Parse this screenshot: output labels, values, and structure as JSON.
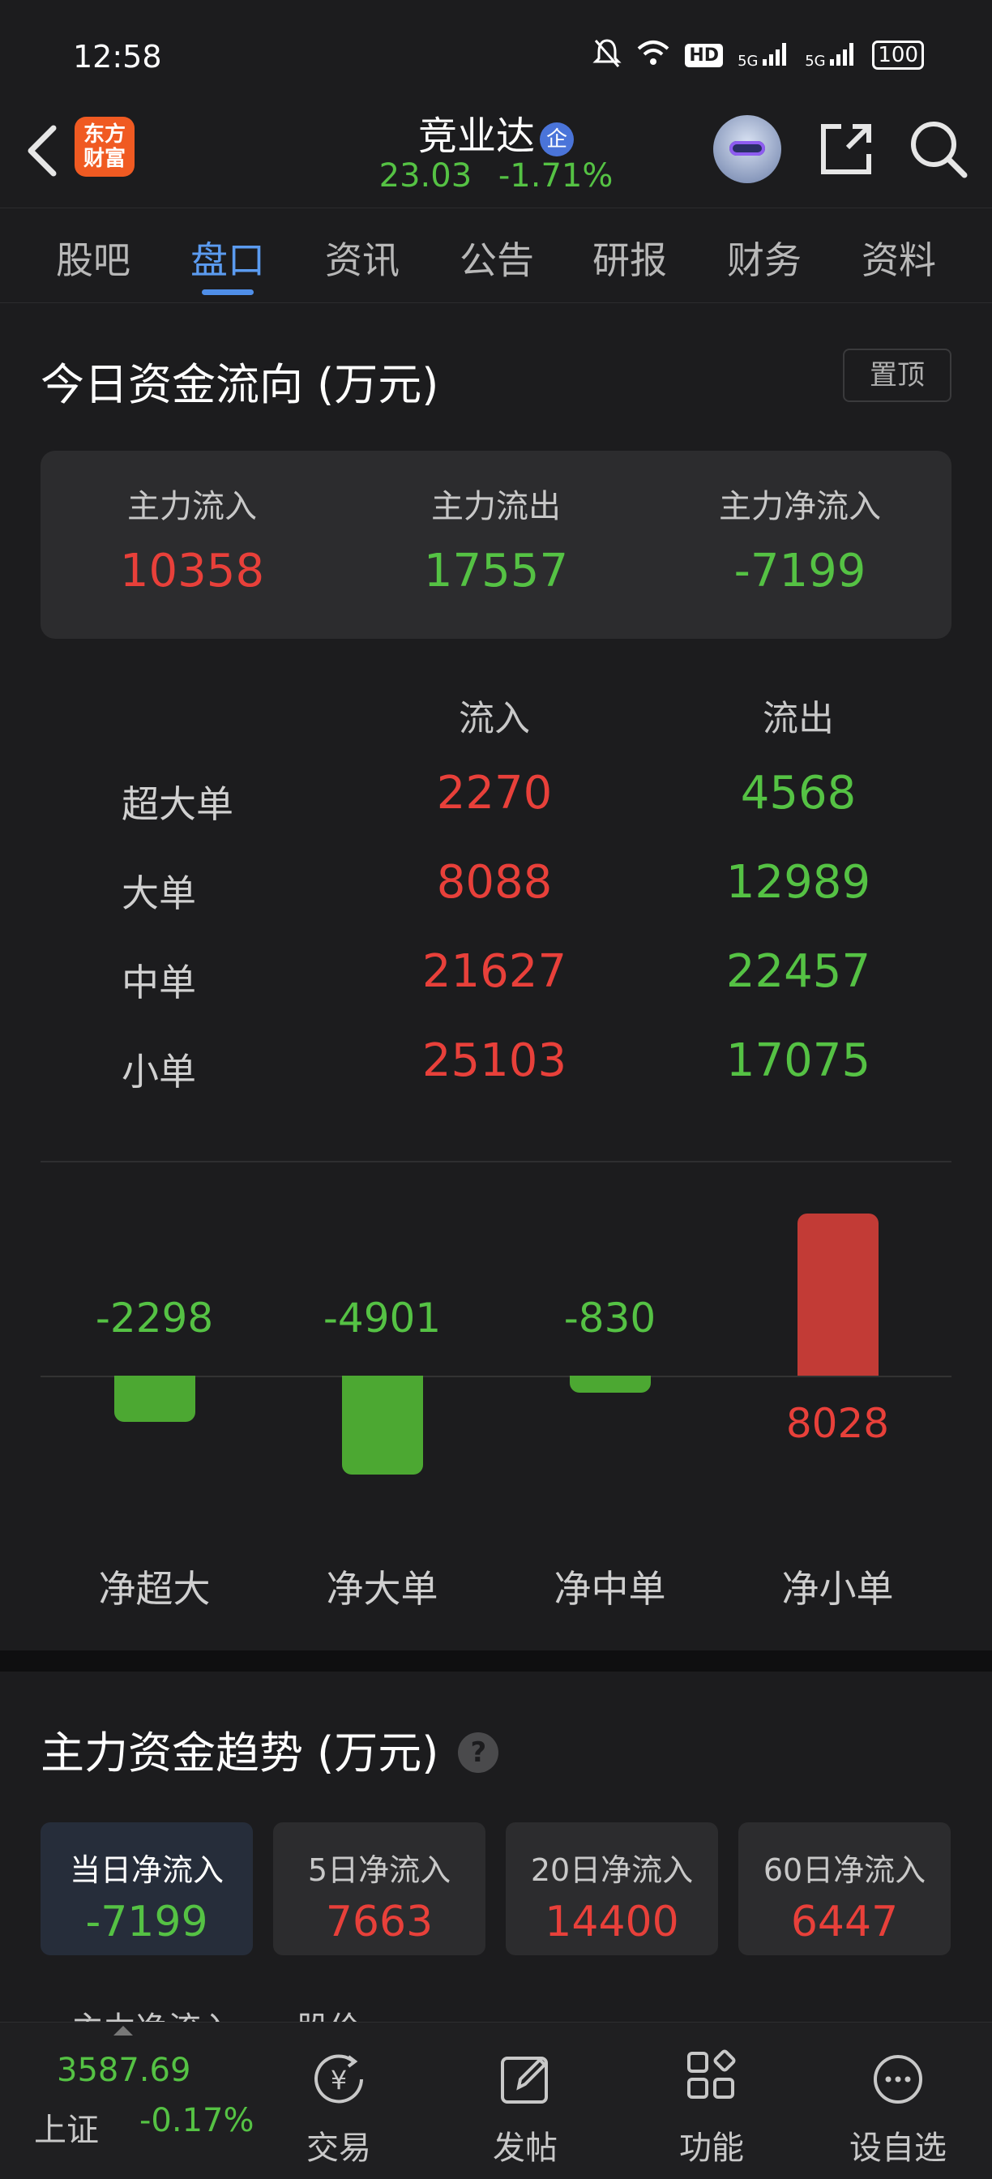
{
  "status_bar": {
    "time": "12:58",
    "battery": "100",
    "network_1": "5G",
    "network_2": "5G",
    "hd": "HD"
  },
  "header": {
    "logo_line1": "东方",
    "logo_line2": "财富",
    "stock_name": "竞业达",
    "badge": "企",
    "price": "23.03",
    "change_pct": "-1.71%"
  },
  "tabs": [
    {
      "label": "股吧"
    },
    {
      "label": "盘口",
      "active": true
    },
    {
      "label": "资讯"
    },
    {
      "label": "公告"
    },
    {
      "label": "研报"
    },
    {
      "label": "财务"
    },
    {
      "label": "资料"
    }
  ],
  "fund_flow": {
    "title": "今日资金流向 (万元)",
    "pin_label": "置顶",
    "summary": {
      "inflow_label": "主力流入",
      "inflow_value": "10358",
      "outflow_label": "主力流出",
      "outflow_value": "17557",
      "net_label": "主力净流入",
      "net_value": "-7199"
    },
    "table_headers": {
      "in": "流入",
      "out": "流出"
    },
    "rows": [
      {
        "label": "超大单",
        "in": "2270",
        "out": "4568"
      },
      {
        "label": "大单",
        "in": "8088",
        "out": "12989"
      },
      {
        "label": "中单",
        "in": "21627",
        "out": "22457"
      },
      {
        "label": "小单",
        "in": "25103",
        "out": "17075"
      }
    ]
  },
  "chart_data": {
    "type": "bar",
    "categories": [
      "净超大",
      "净大单",
      "净中单",
      "净小单"
    ],
    "values": [
      -2298,
      -4901,
      -830,
      8028
    ],
    "value_labels": [
      "-2298",
      "-4901",
      "-830",
      "8028"
    ],
    "colors": {
      "positive": "#c23b36",
      "negative": "#4ca832"
    }
  },
  "trend": {
    "title": "主力资金趋势 (万元)",
    "help": "?",
    "periods": [
      {
        "label": "当日净流入",
        "value": "-7199",
        "color": "green",
        "active": true
      },
      {
        "label": "5日净流入",
        "value": "7663",
        "color": "red"
      },
      {
        "label": "20日净流入",
        "value": "14400",
        "color": "red"
      },
      {
        "label": "60日净流入",
        "value": "6447",
        "color": "red"
      }
    ],
    "legend": [
      {
        "label": "主力净流入",
        "color": "#4f8ee8"
      },
      {
        "label": "股价",
        "color": "#f0a830"
      }
    ]
  },
  "bottom_bar": {
    "index_value": "3587.69",
    "index_name": "上证",
    "index_change": "-0.17%",
    "items": [
      {
        "label": "交易",
        "icon": "yuan-exchange-icon"
      },
      {
        "label": "发帖",
        "icon": "edit-icon"
      },
      {
        "label": "功能",
        "icon": "grid-icon"
      },
      {
        "label": "设自选",
        "icon": "more-icon"
      }
    ]
  }
}
